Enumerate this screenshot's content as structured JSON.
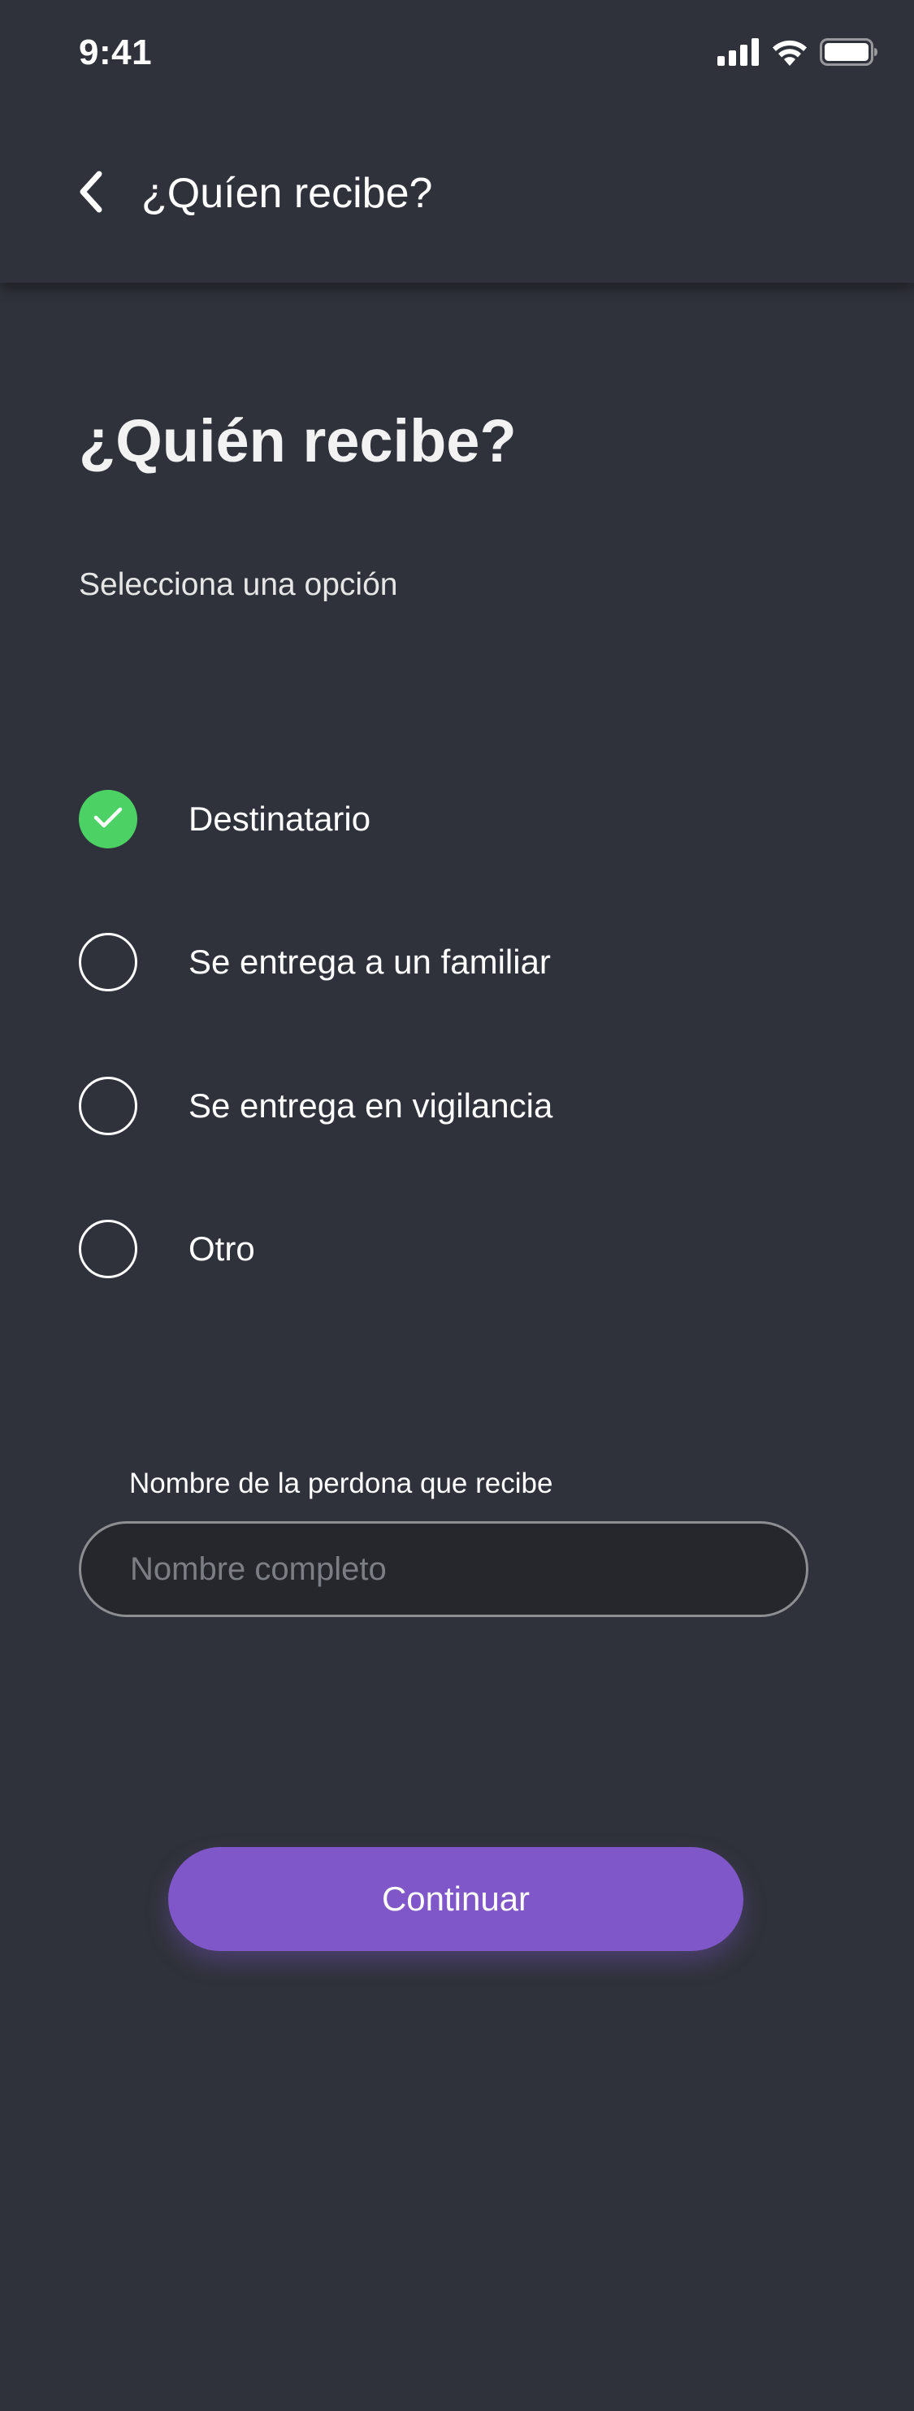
{
  "status_bar": {
    "time": "9:41"
  },
  "header": {
    "title": "¿Quíen recibe?"
  },
  "main": {
    "title": "¿Quién recibe?",
    "subtitle": "Selecciona una opción",
    "options": [
      {
        "label": "Destinatario",
        "selected": true
      },
      {
        "label": "Se entrega a un familiar",
        "selected": false
      },
      {
        "label": "Se entrega en vigilancia",
        "selected": false
      },
      {
        "label": "Otro",
        "selected": false
      }
    ],
    "name_field": {
      "label": "Nombre de la perdona que recibe",
      "placeholder": "Nombre completo",
      "value": ""
    },
    "continue_label": "Continuar"
  },
  "icons": {
    "back": "chevron-left-icon",
    "signal": "cellular-signal-icon",
    "wifi": "wifi-icon",
    "battery": "battery-icon",
    "check": "checkmark-icon"
  },
  "colors": {
    "background": "#2f323a",
    "accent": "#7f57c8",
    "selected": "#4cd264",
    "input_background": "#25272c"
  }
}
